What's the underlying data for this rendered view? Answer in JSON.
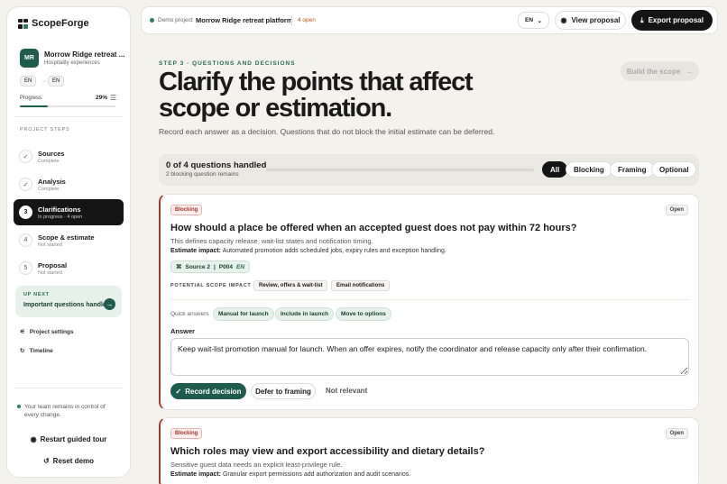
{
  "brand": {
    "name": "ScopeForge"
  },
  "project": {
    "initials": "MR",
    "name": "Morrow Ridge retreat ...",
    "category": "Hospitality experiences",
    "lang_from": "EN",
    "lang_to": "EN",
    "progress_label": "Progress",
    "progress_pct": "29%",
    "progress_value": 0.29
  },
  "steps_label": "PROJECT STEPS",
  "steps": [
    {
      "num": "✓",
      "title": "Sources",
      "sub": "Complete"
    },
    {
      "num": "✓",
      "title": "Analysis",
      "sub": "Complete"
    },
    {
      "num": "3",
      "title": "Clarifications",
      "sub": "In progress · 4 open"
    },
    {
      "num": "4",
      "title": "Scope & estimate",
      "sub": "Not started"
    },
    {
      "num": "5",
      "title": "Proposal",
      "sub": "Not started"
    }
  ],
  "up_next": {
    "label": "UP NEXT",
    "text": "Important questions handled"
  },
  "side_links": {
    "settings": "Project settings",
    "timeline": "Timeline"
  },
  "team_note": "Your team remains in control of every change.",
  "side_buttons": {
    "tour": "Restart guided tour",
    "reset": "Reset demo"
  },
  "topbar": {
    "demo_label": "Demo project",
    "project_name": "Morrow Ridge retreat platform",
    "open_count": "4 open",
    "lang": "EN",
    "view_label": "View proposal",
    "export_label": "Export proposal"
  },
  "page": {
    "eyebrow": "STEP 3 · QUESTIONS AND DECISIONS",
    "title": "Clarify the points that affect scope or estimation.",
    "subtitle": "Record each answer as a decision. Questions that do not block the initial estimate can be deferred.",
    "build_label": "Build the scope"
  },
  "filter": {
    "count": "0 of 4 questions handled",
    "sub": "2 blocking question remains",
    "handled_fraction": 0,
    "chips": [
      "All",
      "Blocking",
      "Framing",
      "Optional"
    ]
  },
  "cards": [
    {
      "tag": "Blocking",
      "status": "Open",
      "question": "How should a place be offered when an accepted guest does not pay within 72 hours?",
      "description": "This defines capacity release, wait-list states and notification timing.",
      "impact_label": "Estimate impact:",
      "impact": "Automated promotion adds scheduled jobs, expiry rules and exception handling.",
      "source": "Source 2",
      "source_ref": "P004",
      "source_lang": "EN",
      "psi_label": "POTENTIAL SCOPE IMPACT",
      "impact_tags": [
        "Review, offers & wait-list",
        "Email notifications"
      ],
      "quick_label": "Quick answers",
      "quick_answers": [
        "Manual for launch",
        "Include in launch",
        "Move to options"
      ],
      "answer_label": "Answer",
      "answer": "Keep wait-list promotion manual for launch. When an offer expires, notify the coordinator and release capacity only after their confirmation.",
      "record_label": "Record decision",
      "defer_label": "Defer to framing",
      "notrel_label": "Not relevant"
    },
    {
      "tag": "Blocking",
      "status": "Open",
      "question": "Which roles may view and export accessibility and dietary details?",
      "description": "Sensitive guest data needs an explicit least-privilege rule.",
      "impact_label": "Estimate impact:",
      "impact": "Granular export permissions add authorization and audit scenarios."
    }
  ]
}
